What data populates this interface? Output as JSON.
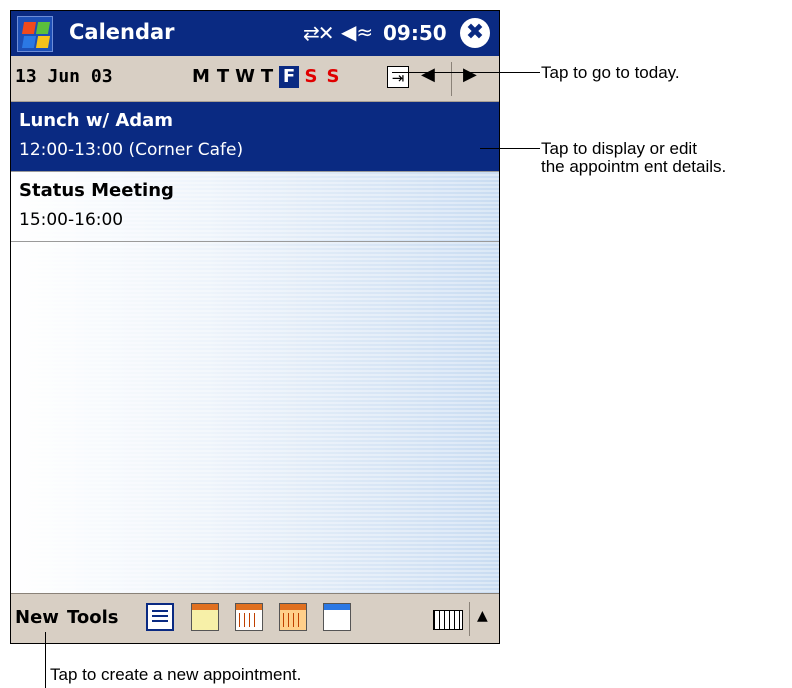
{
  "titlebar": {
    "app_title": "Calendar",
    "clock": "09:50",
    "connectivity_icon": "connectivity-icon",
    "volume_icon": "speaker-icon",
    "close_glyph": "✖"
  },
  "datebar": {
    "date": "13 Jun 03",
    "weekdays": [
      "M",
      "T",
      "W",
      "T",
      "F",
      "S",
      "S"
    ],
    "selected_index": 4,
    "today_glyph": "⇥",
    "prev_glyph": "◀",
    "next_glyph": "▶"
  },
  "appointments": [
    {
      "title": "Lunch w/ Adam",
      "time": "12:00-13:00 (Corner Cafe)",
      "selected": true
    },
    {
      "title": "Status Meeting",
      "time": "15:00-16:00",
      "selected": false
    }
  ],
  "toolbar": {
    "new_label": "New",
    "tools_label": "Tools",
    "views": [
      "agenda-view-icon",
      "day-view-icon",
      "week-view-icon",
      "month-view-icon",
      "year-view-icon"
    ],
    "keyboard_icon": "keyboard-icon",
    "up_glyph": "▲"
  },
  "callouts": {
    "today": "Tap to go to today.",
    "details_line1": "Tap to display or edit",
    "details_line2": "the appointm ent details.",
    "new": "Tap to create a new appointment."
  },
  "colors": {
    "titlebar": "#0a2a82",
    "selection": "#0a2a82",
    "weekend": "#e00000",
    "bar_bg": "#d8cfc4"
  }
}
